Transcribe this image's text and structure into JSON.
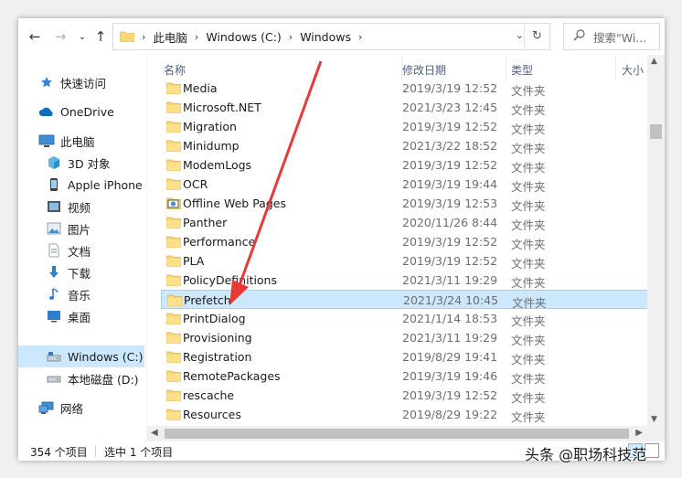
{
  "address_bar": {
    "breadcrumbs": [
      "此电脑",
      "Windows (C:)",
      "Windows"
    ]
  },
  "search": {
    "placeholder": "搜索\"Wi..."
  },
  "sidebar": {
    "items": [
      {
        "label": "快速访问",
        "icon": "quick-access-star-icon"
      },
      {
        "label": "OneDrive",
        "icon": "onedrive-cloud-icon"
      },
      {
        "label": "此电脑",
        "icon": "this-pc-icon"
      },
      {
        "label": "3D 对象",
        "icon": "3d-objects-icon"
      },
      {
        "label": "Apple iPhone",
        "icon": "iphone-icon"
      },
      {
        "label": "视频",
        "icon": "videos-icon"
      },
      {
        "label": "图片",
        "icon": "pictures-icon"
      },
      {
        "label": "文档",
        "icon": "documents-icon"
      },
      {
        "label": "下载",
        "icon": "downloads-icon"
      },
      {
        "label": "音乐",
        "icon": "music-icon"
      },
      {
        "label": "桌面",
        "icon": "desktop-icon"
      },
      {
        "label": "Windows (C:)",
        "icon": "drive-c-icon",
        "selected": true
      },
      {
        "label": "本地磁盘 (D:)",
        "icon": "drive-d-icon"
      },
      {
        "label": "网络",
        "icon": "network-icon"
      }
    ]
  },
  "columns": {
    "name": "名称",
    "date": "修改日期",
    "type": "类型",
    "size": "大小"
  },
  "files": [
    {
      "name": "Media",
      "date": "2019/3/19 12:52",
      "type": "文件夹"
    },
    {
      "name": "Microsoft.NET",
      "date": "2021/3/23 12:45",
      "type": "文件夹"
    },
    {
      "name": "Migration",
      "date": "2019/3/19 12:52",
      "type": "文件夹"
    },
    {
      "name": "Minidump",
      "date": "2021/3/22 18:52",
      "type": "文件夹"
    },
    {
      "name": "ModemLogs",
      "date": "2019/3/19 12:52",
      "type": "文件夹"
    },
    {
      "name": "OCR",
      "date": "2019/3/19 19:44",
      "type": "文件夹"
    },
    {
      "name": "Offline Web Pages",
      "date": "2019/3/19 12:53",
      "type": "文件夹",
      "special_icon": true
    },
    {
      "name": "Panther",
      "date": "2020/11/26 8:44",
      "type": "文件夹"
    },
    {
      "name": "Performance",
      "date": "2019/3/19 12:52",
      "type": "文件夹"
    },
    {
      "name": "PLA",
      "date": "2019/3/19 12:52",
      "type": "文件夹"
    },
    {
      "name": "PolicyDefinitions",
      "date": "2021/3/11 19:29",
      "type": "文件夹"
    },
    {
      "name": "Prefetch",
      "date": "2021/3/24 10:45",
      "type": "文件夹",
      "selected": true
    },
    {
      "name": "PrintDialog",
      "date": "2021/1/14 18:53",
      "type": "文件夹"
    },
    {
      "name": "Provisioning",
      "date": "2021/3/11 19:29",
      "type": "文件夹"
    },
    {
      "name": "Registration",
      "date": "2019/8/29 19:41",
      "type": "文件夹"
    },
    {
      "name": "RemotePackages",
      "date": "2019/3/19 19:46",
      "type": "文件夹"
    },
    {
      "name": "rescache",
      "date": "2019/3/19 12:52",
      "type": "文件夹"
    },
    {
      "name": "Resources",
      "date": "2019/8/29 19:22",
      "type": "文件夹"
    }
  ],
  "status": {
    "item_count": "354 个项目",
    "selected_count": "选中 1 个项目"
  },
  "watermark": "头条 @职场科技范",
  "colors": {
    "selection": "#cce8ff",
    "arrow": "#e83a35",
    "folder": "#f8d775"
  }
}
